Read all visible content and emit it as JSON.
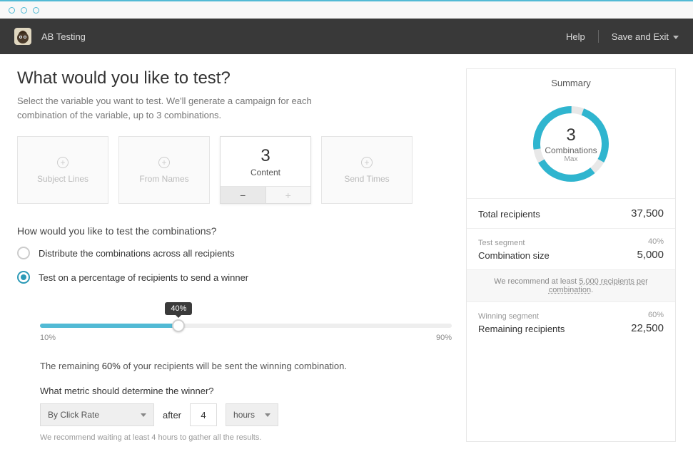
{
  "header": {
    "title": "AB Testing",
    "help_label": "Help",
    "save_exit_label": "Save and Exit"
  },
  "main": {
    "heading": "What would you like to test?",
    "subtext": "Select the variable you want to test. We'll generate a campaign for each combination of the variable, up to 3 combinations.",
    "cards": {
      "subject_lines": "Subject Lines",
      "from_names": "From Names",
      "content": "Content",
      "content_count": "3",
      "send_times": "Send Times"
    },
    "combinations_heading": "How would you like to test the combinations?",
    "option_distribute": "Distribute the combinations across all recipients",
    "option_percentage": "Test on a percentage of recipients to send a winner",
    "slider": {
      "min_label": "10%",
      "max_label": "90%",
      "tooltip": "40%",
      "percent": 40
    },
    "remaining_prefix": "The remaining",
    "remaining_pct": "60%",
    "remaining_suffix": "of your recipients will be sent the winning combination.",
    "metric_label": "What metric should determine the winner?",
    "metric_select": "By Click Rate",
    "after_label": "after",
    "after_value": "4",
    "hours_select": "hours",
    "hint": "We recommend waiting at least 4 hours to gather all the results."
  },
  "summary": {
    "title": "Summary",
    "donut_number": "3",
    "donut_label": "Combinations",
    "donut_sub": "Max",
    "total_recipients_label": "Total recipients",
    "total_recipients_value": "37,500",
    "test_segment_label": "Test segment",
    "test_segment_pct": "40%",
    "combination_size_label": "Combination size",
    "combination_size_value": "5,000",
    "recommend_prefix": "We recommend at least",
    "recommend_link": "5,000 recipients per combination",
    "winning_segment_label": "Winning segment",
    "winning_segment_pct": "60%",
    "remaining_recipients_label": "Remaining recipients",
    "remaining_recipients_value": "22,500"
  }
}
